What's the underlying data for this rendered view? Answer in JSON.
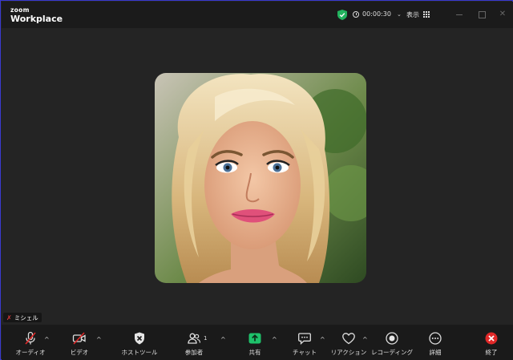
{
  "app": {
    "logo_small": "zoom",
    "logo_big": "Workplace"
  },
  "titlebar": {
    "timer": "00:00:30",
    "view_label": "表示",
    "security_color": "#22b35e"
  },
  "participant": {
    "name": "ミシェル",
    "muted": true
  },
  "toolbar": {
    "audio": "オーディオ",
    "video": "ビデオ",
    "host_tools": "ホストツール",
    "participants": "参加者",
    "participants_count": "1",
    "share": "共有",
    "chat": "チャット",
    "reactions": "リアクション",
    "recording": "レコーディング",
    "more": "詳細",
    "end": "終了",
    "share_color": "#1ec16a",
    "end_color": "#e02828"
  },
  "icons": [
    "zoom-logo",
    "shield-check-icon",
    "clock-icon",
    "grid-icon",
    "mic-off-icon",
    "video-off-icon",
    "shield-icon",
    "people-icon",
    "share-up-icon",
    "chat-icon",
    "heart-icon",
    "record-icon",
    "ellipsis-icon",
    "close-icon"
  ]
}
